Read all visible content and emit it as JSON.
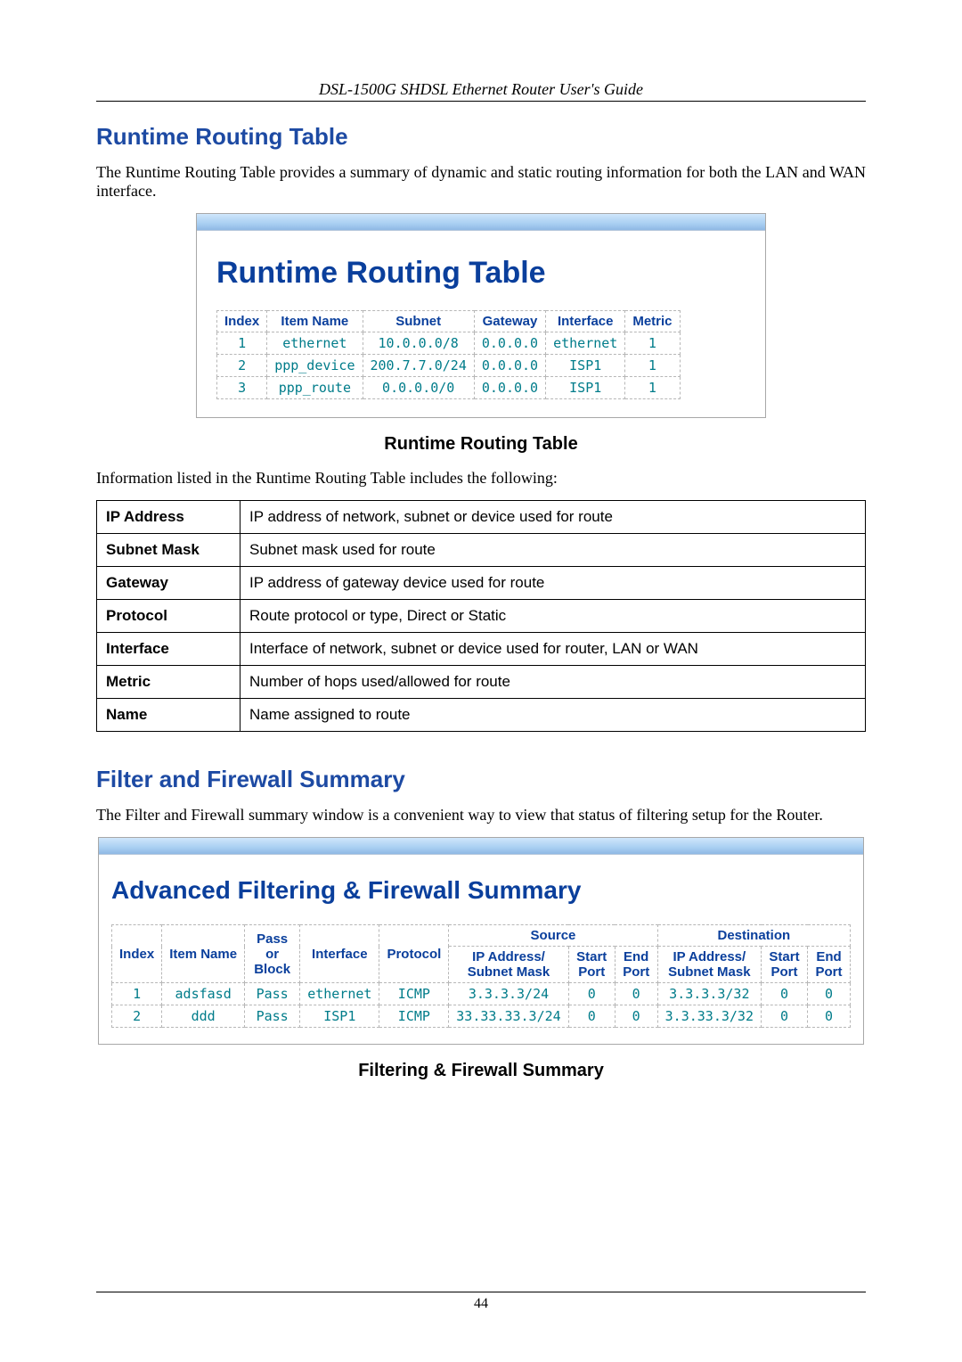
{
  "header": {
    "title": "DSL-1500G SHDSL Ethernet Router User's Guide"
  },
  "section1": {
    "heading": "Runtime Routing Table",
    "intro": "The Runtime Routing Table provides a summary of dynamic and static routing information for both the LAN and WAN interface.",
    "panel": {
      "title": "Runtime Routing Table",
      "columns": {
        "c0": "Index",
        "c1": "Item Name",
        "c2": "Subnet",
        "c3": "Gateway",
        "c4": "Interface",
        "c5": "Metric"
      },
      "rows": [
        {
          "index": "1",
          "name": "ethernet",
          "subnet": "10.0.0.0/8",
          "gateway": "0.0.0.0",
          "iface": "ethernet",
          "metric": "1"
        },
        {
          "index": "2",
          "name": "ppp_device",
          "subnet": "200.7.7.0/24",
          "gateway": "0.0.0.0",
          "iface": "ISP1",
          "metric": "1"
        },
        {
          "index": "3",
          "name": "ppp_route",
          "subnet": "0.0.0.0/0",
          "gateway": "0.0.0.0",
          "iface": "ISP1",
          "metric": "1"
        }
      ]
    },
    "caption": "Runtime Routing Table",
    "desc_intro": "Information listed in the Runtime Routing Table includes the following:",
    "desc_table": [
      {
        "k": "IP Address",
        "v": "IP address of network, subnet or device used for route"
      },
      {
        "k": "Subnet Mask",
        "v": "Subnet mask used for route"
      },
      {
        "k": "Gateway",
        "v": "IP address of gateway device used for route"
      },
      {
        "k": "Protocol",
        "v": "Route protocol or type, Direct or Static"
      },
      {
        "k": "Interface",
        "v": "Interface of network, subnet or device used for router, LAN or WAN"
      },
      {
        "k": "Metric",
        "v": "Number of hops used/allowed for route"
      },
      {
        "k": "Name",
        "v": "Name assigned to route"
      }
    ]
  },
  "section2": {
    "heading": "Filter and Firewall Summary",
    "intro": "The Filter and Firewall summary window is a convenient way to view that status of filtering setup for the Router.",
    "panel": {
      "title": "Advanced Filtering & Firewall Summary",
      "group_headers": {
        "source": "Source",
        "dest": "Destination"
      },
      "columns": {
        "c0": "Index",
        "c1": "Item Name",
        "c2": "Pass or Block",
        "c3": "Interface",
        "c4": "Protocol",
        "c5": "IP Address/ Subnet Mask",
        "c6": "Start Port",
        "c7": "End Port",
        "c8": "IP Address/ Subnet Mask",
        "c9": "Start Port",
        "c10": "End Port"
      },
      "rows": [
        {
          "index": "1",
          "name": "adsfasd",
          "pb": "Pass",
          "iface": "ethernet",
          "proto": "ICMP",
          "sip": "3.3.3.3/24",
          "ssp": "0",
          "sep": "0",
          "dip": "3.3.3.3/32",
          "dsp": "0",
          "dep": "0"
        },
        {
          "index": "2",
          "name": "ddd",
          "pb": "Pass",
          "iface": "ISP1",
          "proto": "ICMP",
          "sip": "33.33.33.3/24",
          "ssp": "0",
          "sep": "0",
          "dip": "3.3.33.3/32",
          "dsp": "0",
          "dep": "0"
        }
      ]
    },
    "caption": "Filtering & Firewall Summary"
  },
  "footer": {
    "page": "44"
  }
}
